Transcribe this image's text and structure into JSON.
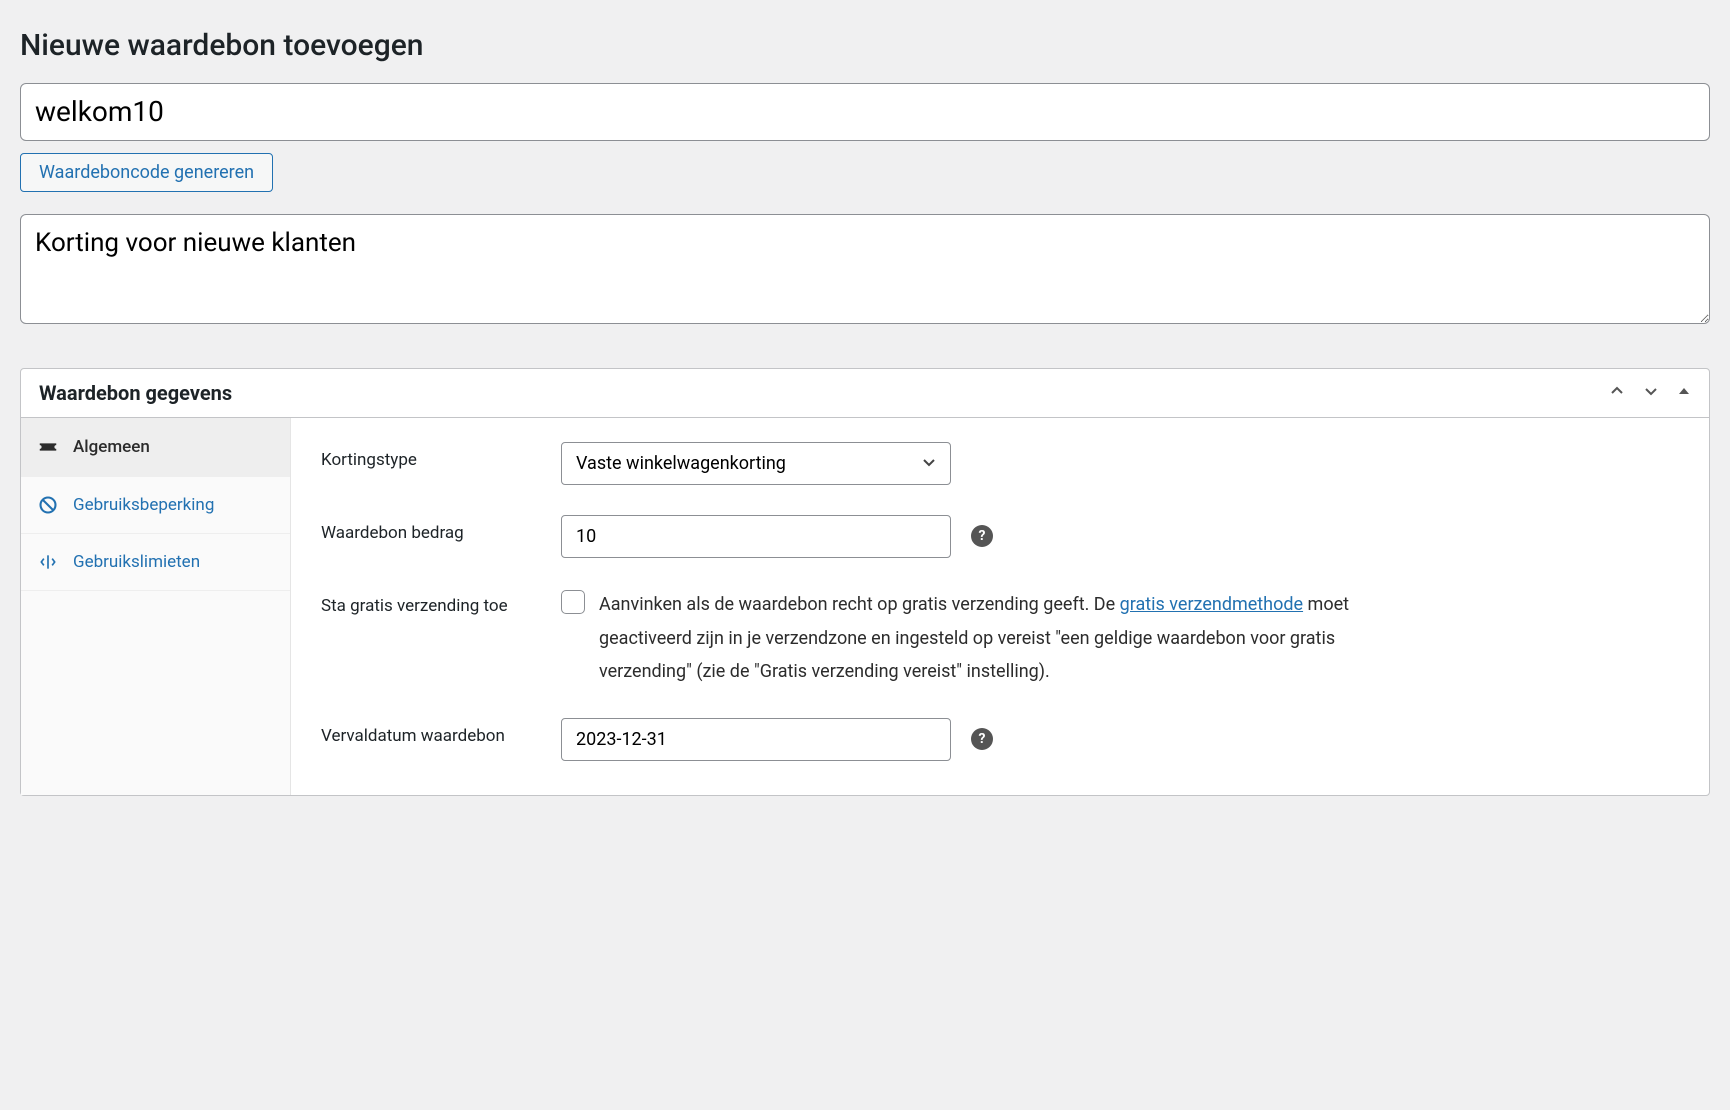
{
  "page_title": "Nieuwe waardebon toevoegen",
  "coupon_code": "welkom10",
  "generate_button": "Waardeboncode genereren",
  "description": "Korting voor nieuwe klanten",
  "panel_title": "Waardebon gegevens",
  "tabs": {
    "general": "Algemeen",
    "restriction": "Gebruiksbeperking",
    "limits": "Gebruikslimieten"
  },
  "fields": {
    "discount_type_label": "Kortingstype",
    "discount_type_value": "Vaste winkelwagenkorting",
    "amount_label": "Waardebon bedrag",
    "amount_value": "10",
    "free_shipping_label": "Sta gratis verzending toe",
    "free_shipping_desc_1": "Aanvinken als de waardebon recht op gratis verzending geeft. De ",
    "free_shipping_link": "gratis verzendmethode",
    "free_shipping_desc_2": " moet geactiveerd zijn in je verzendzone en ingesteld op vereist \"een geldige waardebon voor gratis verzending\" (zie de \"Gratis verzending vereist\" instelling).",
    "expiry_label": "Vervaldatum waardebon",
    "expiry_value": "2023-12-31"
  }
}
